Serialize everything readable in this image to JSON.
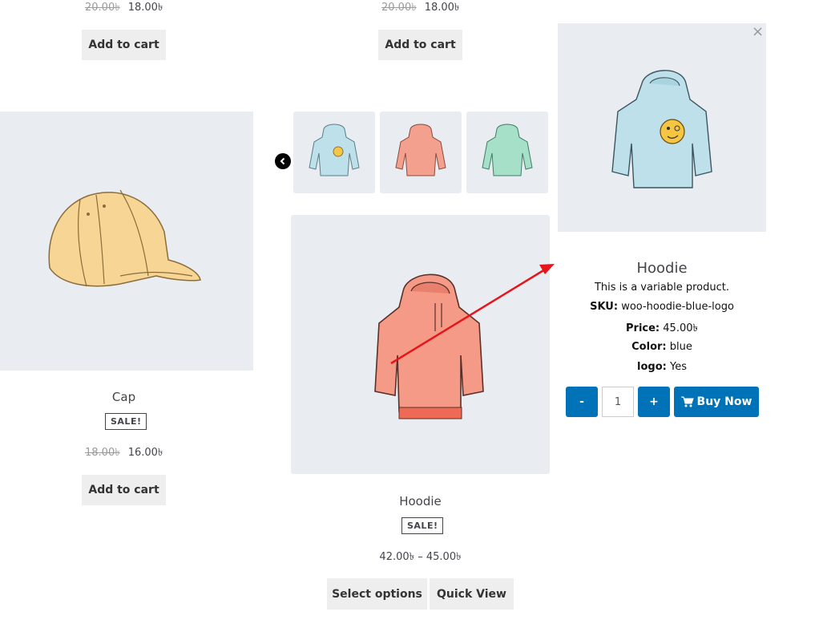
{
  "currency": "৳",
  "top_products": [
    {
      "old_price": "20.00৳",
      "new_price": "18.00৳",
      "button": "Add to cart"
    },
    {
      "old_price": "20.00৳",
      "new_price": "18.00৳",
      "button": "Add to cart"
    }
  ],
  "cap": {
    "title": "Cap",
    "badge": "SALE!",
    "old_price": "18.00৳",
    "new_price": "16.00৳",
    "button": "Add to cart"
  },
  "hoodie": {
    "title": "Hoodie",
    "badge": "SALE!",
    "price_range": "42.00৳ – 45.00৳",
    "select_button": "Select options",
    "quick_view_button": "Quick View",
    "prev_icon": "chevron-left-icon"
  },
  "quick_view": {
    "close": "×",
    "title": "Hoodie",
    "description": "This is a variable product.",
    "sku_label": "SKU:",
    "sku_value": "woo-hoodie-blue-logo",
    "price_label": "Price:",
    "price_value": "45.00৳",
    "color_label": "Color:",
    "color_value": "blue",
    "logo_label": "logo:",
    "logo_value": "Yes",
    "minus": "-",
    "quantity": "1",
    "plus": "+",
    "buy_now": "Buy Now"
  },
  "colors": {
    "accent_blue": "#0073b8",
    "arrow_red": "#e8141b",
    "image_bg": "#e9edf1",
    "button_grey": "#eeeeee"
  }
}
